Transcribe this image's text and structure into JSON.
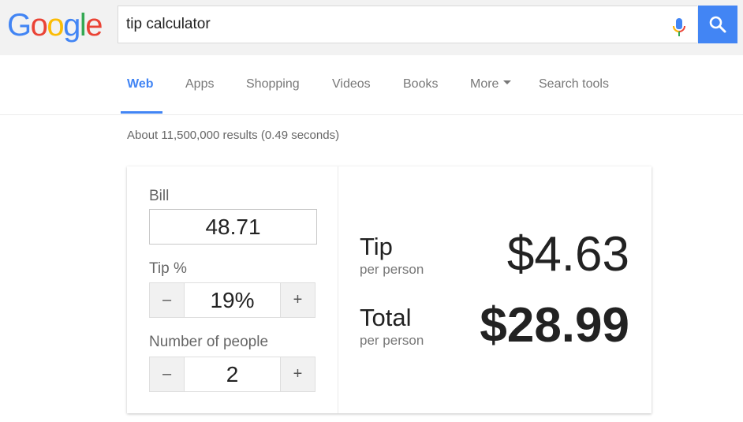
{
  "logo": {
    "text": "Google",
    "letters": [
      {
        "ch": "G",
        "color": "#4285f4"
      },
      {
        "ch": "o",
        "color": "#ea4335"
      },
      {
        "ch": "o",
        "color": "#fbbc05"
      },
      {
        "ch": "g",
        "color": "#4285f4"
      },
      {
        "ch": "l",
        "color": "#34a853"
      },
      {
        "ch": "e",
        "color": "#ea4335"
      }
    ]
  },
  "search": {
    "query": "tip calculator"
  },
  "nav": {
    "items": [
      {
        "label": "Web",
        "active": true
      },
      {
        "label": "Apps"
      },
      {
        "label": "Shopping"
      },
      {
        "label": "Videos"
      },
      {
        "label": "Books"
      },
      {
        "label": "More"
      },
      {
        "label": "Search tools"
      }
    ]
  },
  "stats": "About 11,500,000 results (0.49 seconds)",
  "calculator": {
    "bill_label": "Bill",
    "bill_value": "48.71",
    "tip_label": "Tip %",
    "tip_value": "19%",
    "people_label": "Number of people",
    "people_value": "2",
    "minus": "–",
    "plus": "+",
    "tip_result_label": "Tip",
    "tip_result_sub": "per person",
    "tip_result_value": "$4.63",
    "total_result_label": "Total",
    "total_result_sub": "per person",
    "total_result_value": "$28.99"
  },
  "colors": {
    "accent": "#4285f4"
  }
}
